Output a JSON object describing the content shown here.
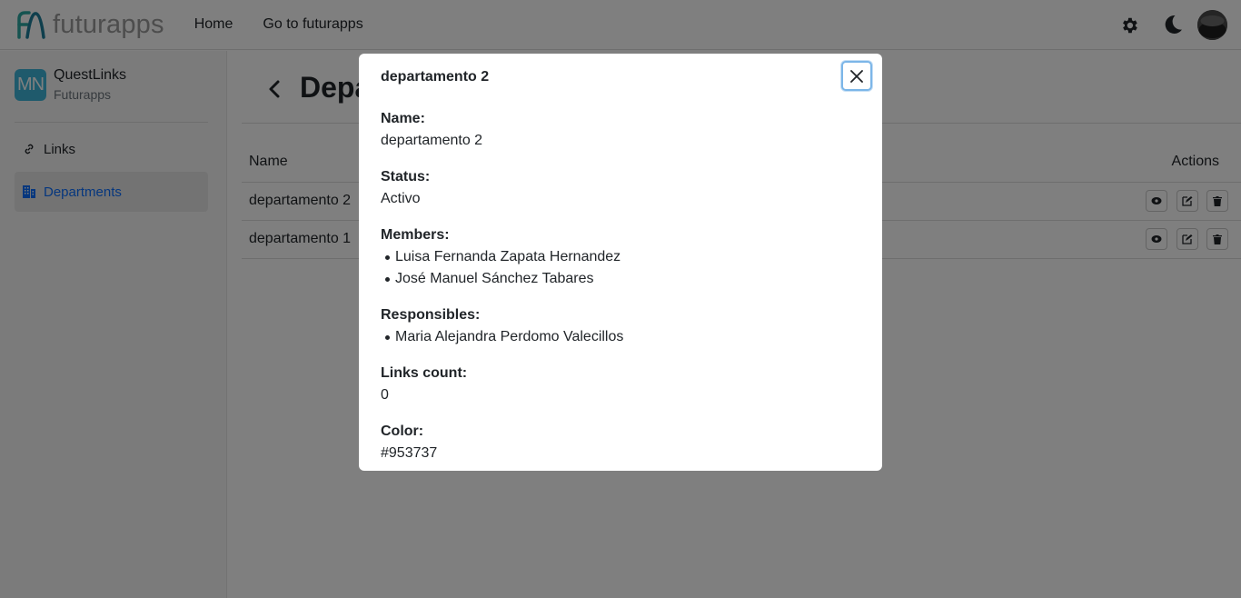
{
  "header": {
    "logo_text": "futurapps",
    "nav": [
      "Home",
      "Go to futurapps"
    ],
    "icons": [
      "gear-icon",
      "moon-icon",
      "avatar"
    ]
  },
  "sidebar": {
    "org_badge": "MN",
    "org_name": "QuestLinks",
    "org_sub": "Futurapps",
    "items": [
      {
        "label": "Links",
        "icon": "link-icon",
        "active": false
      },
      {
        "label": "Departments",
        "icon": "building-icon",
        "active": true
      }
    ]
  },
  "main": {
    "title": "Depa",
    "columns": {
      "name": "Name",
      "actions": "Actions"
    },
    "rows": [
      {
        "name": "departamento 2"
      },
      {
        "name": "departamento 1"
      }
    ]
  },
  "modal": {
    "title": "departamento 2",
    "fields": {
      "name_label": "Name:",
      "name_value": "departamento 2",
      "status_label": "Status:",
      "status_value": "Activo",
      "members_label": "Members:",
      "members": [
        "Luisa Fernanda Zapata Hernandez",
        "José Manuel Sánchez Tabares"
      ],
      "responsibles_label": "Responsibles:",
      "responsibles": [
        "Maria Alejandra Perdomo Valecillos"
      ],
      "links_label": "Links count:",
      "links_value": "0",
      "color_label": "Color:",
      "color_value": "#953737"
    }
  },
  "colors": {
    "accent": "#0d6efd",
    "badge": "#3fb5d8",
    "overlay": "rgba(0,0,0,0.5)"
  }
}
